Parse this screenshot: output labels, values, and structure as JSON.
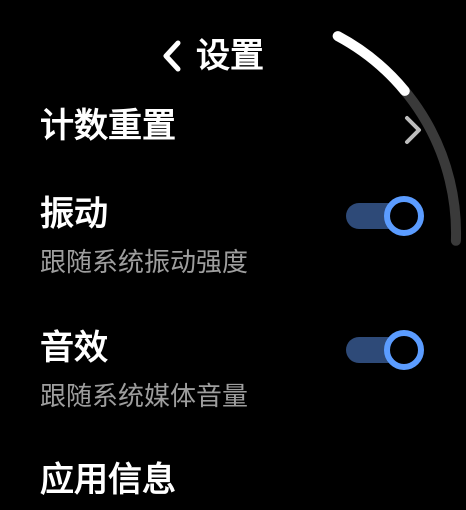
{
  "header": {
    "title": "设置"
  },
  "rows": [
    {
      "title": "计数重置"
    },
    {
      "title": "振动",
      "subtitle": "跟随系统振动强度",
      "toggle_on": true
    },
    {
      "title": "音效",
      "subtitle": "跟随系统媒体音量",
      "toggle_on": true
    },
    {
      "title": "应用信息"
    }
  ],
  "icons": {
    "back": "chevron-left-icon",
    "row_nav": "chevron-right-icon"
  },
  "colors": {
    "background": "#000000",
    "text_primary": "#ffffff",
    "text_secondary": "#9e9e9e",
    "toggle_track_on": "#2e4a78",
    "toggle_knob_ring": "#5b9cff",
    "scroll_track": "#3a3a3a",
    "scroll_thumb": "#ffffff",
    "chevron": "#bdbdbd"
  },
  "scroll": {
    "position_fraction": 0.0,
    "visible_fraction": 0.35
  }
}
